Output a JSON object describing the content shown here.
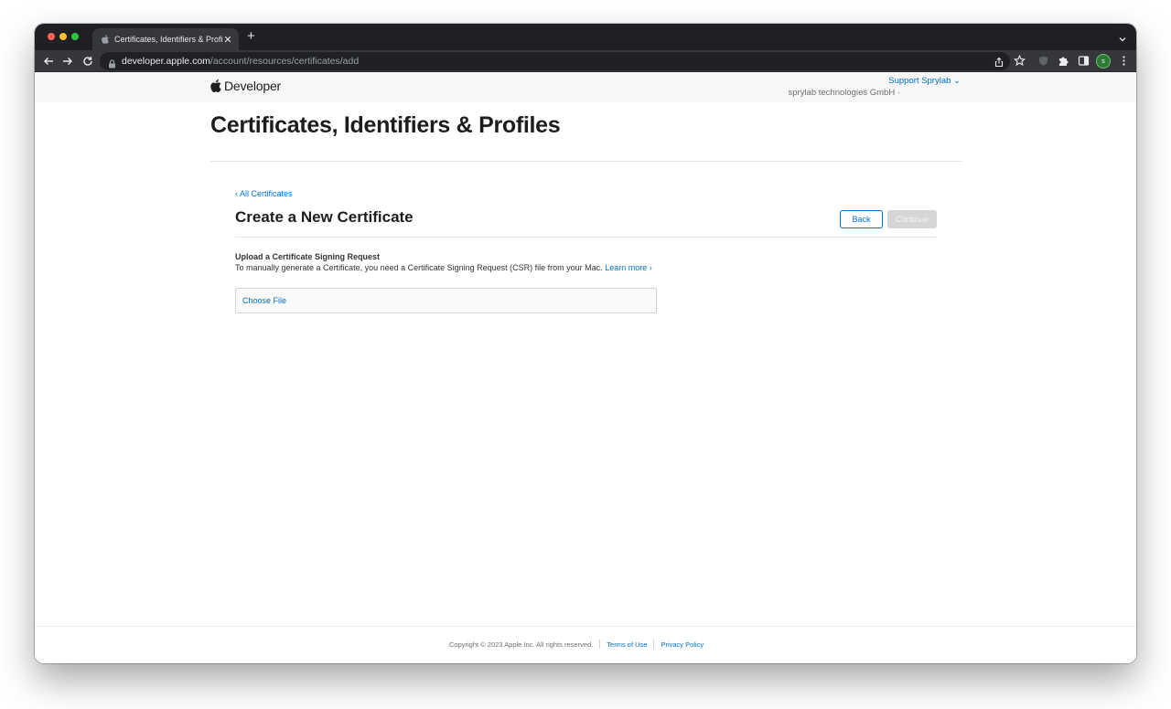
{
  "browser": {
    "tab_title": "Certificates, Identifiers & Profi",
    "url_host": "developer.apple.com",
    "url_path": "/account/resources/certificates/add",
    "profile_initial": "s"
  },
  "header": {
    "logo_text": "Developer",
    "support_label": "Support Sprylab ⌄",
    "team_name": "sprylab technologies GmbH ·"
  },
  "page": {
    "title": "Certificates, Identifiers & Profiles",
    "back_link": "‹ All Certificates",
    "section_title": "Create a New Certificate",
    "back_button": "Back",
    "continue_button": "Continue",
    "upload_heading": "Upload a Certificate Signing Request",
    "upload_description": "To manually generate a Certificate, you need a Certificate Signing Request (CSR) file from your Mac.",
    "learn_more": "Learn more ›",
    "choose_file": "Choose File"
  },
  "footer": {
    "copyright": "Copyright © 2023 Apple Inc. All rights reserved.",
    "terms": "Terms of Use",
    "privacy": "Privacy Policy"
  },
  "colors": {
    "link": "#0070c9",
    "disabled_button": "#d6d6d6",
    "chrome_dark": "#1f2023"
  }
}
